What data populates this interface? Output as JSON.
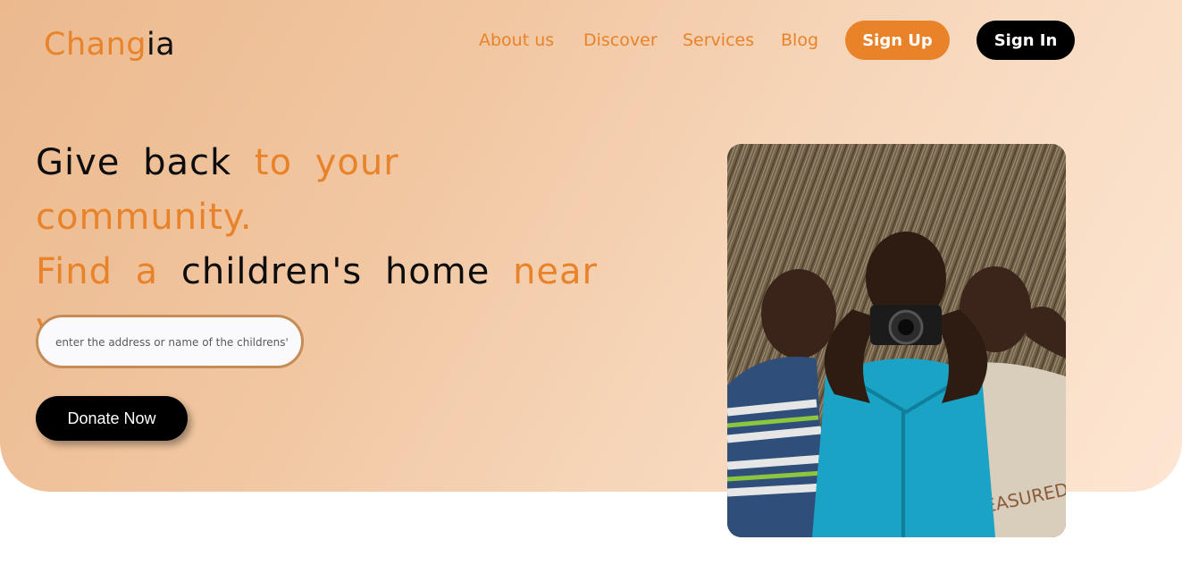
{
  "brand": {
    "part1": "Chang",
    "part2": "ia"
  },
  "nav": {
    "links": [
      "About us",
      "Discover",
      "Services",
      "Blog"
    ],
    "signup_label": "Sign Up",
    "signin_label": "Sign In"
  },
  "hero": {
    "headline": {
      "seg1": "Give back ",
      "seg2": "to your community.",
      "seg3": "Find a ",
      "seg4": "children's home ",
      "seg5": "near you."
    },
    "search": {
      "placeholder": "enter the address or name of the childrens' home"
    },
    "donate_label": "Donate Now"
  },
  "colors": {
    "accent": "#e8832a",
    "dark": "#000000",
    "hero_gradient_start": "#ecb98e",
    "hero_gradient_end": "#fde6d2"
  }
}
